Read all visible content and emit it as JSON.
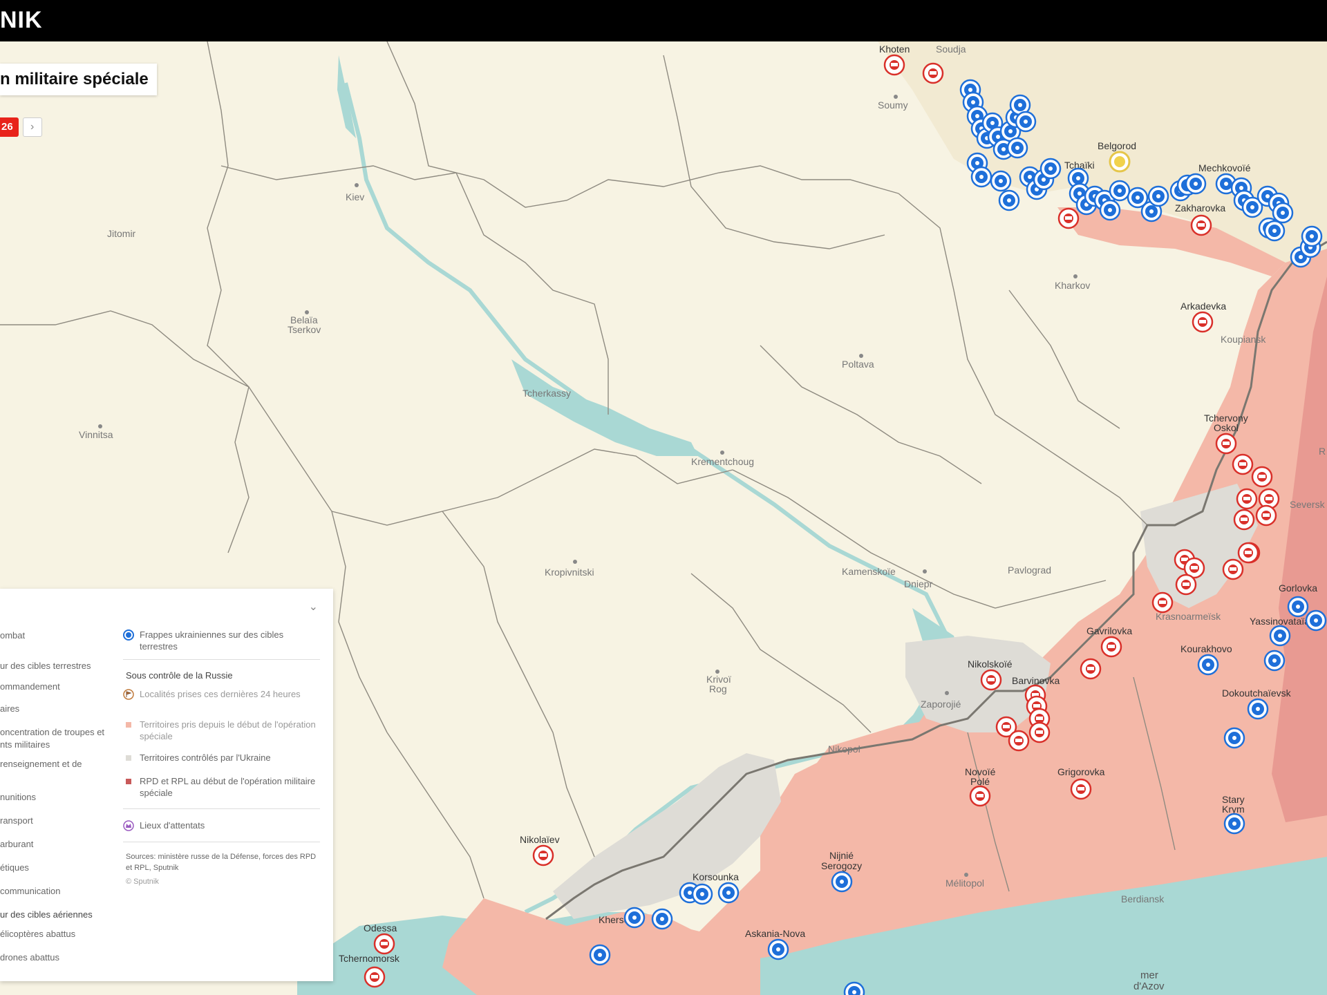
{
  "header": {
    "logo": "NIK"
  },
  "title": "n militaire spéciale",
  "date_chip": "26",
  "next_icon": "chevron-right-icon",
  "colors": {
    "land": "#f6f2e4",
    "sea": "#a9d8d4",
    "ua_strike": "#1e6fd9",
    "ru_marker": "#d9302a",
    "taken": "#f4b8a8",
    "dpr_lpr": "#e89a92",
    "ua_controlled": "#dedcd6"
  },
  "cities": {
    "kiev": "Kiev",
    "jitomir": "Jitomir",
    "belaia": "Belaïa",
    "tserkov": "Tserkov",
    "vinnitsa": "Vinnitsa",
    "tcherkassy": "Tcherkassy",
    "poltava": "Poltava",
    "kremenchoug": "Krementchoug",
    "kropivnitski": "Kropivnitski",
    "kamenskoie": "Kamenskoïe",
    "dniepr": "Dniepr",
    "pavlograd": "Pavlograd",
    "krivoi": "Krivoï",
    "rog": "Rog",
    "zaporojie": "Zaporojié",
    "nikopol": "Nikopol",
    "melitopol": "Mélitopol",
    "berdiansk": "Berdiansk",
    "kherson": "Kherson",
    "nikolaiev": "Nikolaïev",
    "odessa": "Odessa",
    "tchernomorsk": "Tchernomorsk",
    "soumy": "Soumy",
    "kharkov": "Kharkov",
    "belgorod": "Belgorod",
    "khoten": "Khoten",
    "soudja": "Soudja",
    "tchaiki": "Tchaïki",
    "mechkovoie": "Mechkovoïé",
    "zakharovka": "Zakharovka",
    "arkadevka": "Arkadevka",
    "kouplansk": "Koupiansk",
    "tchervony": "Tchervony",
    "oskol": "Oskol",
    "seversk": "Seversk",
    "gorlovka": "Gorlovka",
    "yassinovataia": "Yassinovataïa",
    "krasnoarmeisk": "Krasnoarmeïsk",
    "kourakhovo": "Kourakhovo",
    "dokoutchaievsk": "Dokoutchaïevsk",
    "gavrilovka": "Gavrilovka",
    "nikolskoie": "Nikolskoïé",
    "barvinovka": "Barvinovka",
    "novoie": "Novoïé",
    "pole": "Polé",
    "grigorovka": "Grigorovka",
    "stary": "Stary",
    "krym": "Krym",
    "korsounka": "Korsounka",
    "nijnie": "Nijnié",
    "serogozy": "Serogozy",
    "askania": "Askania-Nova",
    "mer": "mer",
    "dazov": "d'Azov",
    "r_edge": "R"
  },
  "legend": {
    "left": [
      "ombat",
      "ur des cibles terrestres",
      "ommandement",
      "aires",
      "oncentration de troupes et",
      "nts militaires",
      "renseignement et de",
      "nunitions",
      "ransport",
      "arburant",
      "étiques",
      "communication",
      "ur des cibles aériennes",
      "élicoptères abattus",
      "drones abattus"
    ],
    "ua_strikes": "Frappes ukrainiennes sur des cibles terrestres",
    "under_russia": "Sous contrôle de la Russie",
    "taken_24h": "Localités prises ces dernières 24 heures",
    "taken_since": "Territoires pris depuis le début de l'opération spéciale",
    "ua_controlled": "Territoires contrôlés par l'Ukraine",
    "dpr_lpr": "RPD et RPL au début de l'opération militaire spéciale",
    "attacks": "Lieux d'attentats",
    "sources": "Sources: ministère russe de la Défense, forces des RPD et RPL, Sputnik",
    "copyright": "© Sputnik"
  }
}
